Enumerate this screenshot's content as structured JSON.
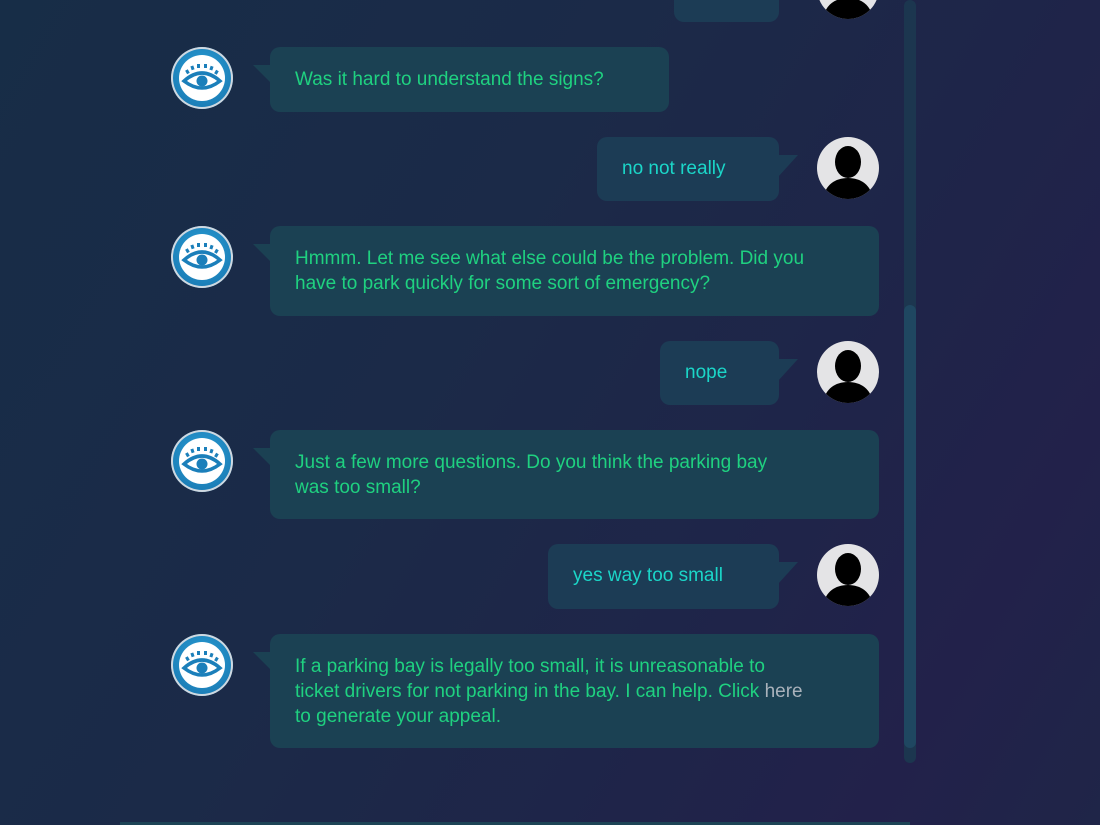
{
  "chat": {
    "messages": [
      {
        "sender": "user",
        "text": "",
        "partial": true
      },
      {
        "sender": "bot",
        "text": "Was it hard to understand the signs?"
      },
      {
        "sender": "user",
        "text": "no not really"
      },
      {
        "sender": "bot",
        "lines": [
          "Hmmm. Let me see what else could be the problem. Did you",
          "have to park quickly for some sort of emergency?"
        ]
      },
      {
        "sender": "user",
        "text": "nope"
      },
      {
        "sender": "bot",
        "lines": [
          "Just a few more questions. Do you think the parking bay",
          "was too small?"
        ]
      },
      {
        "sender": "user",
        "text": "yes way too small"
      },
      {
        "sender": "bot",
        "lines": [
          "If a parking bay is legally too small, it is unreasonable to",
          "ticket drivers for not parking in the bay. I can help. Click ",
          "to generate your appeal."
        ],
        "link_text": "here"
      }
    ],
    "bot_avatar_icon": "eye-icon",
    "user_avatar_icon": "user-silhouette-icon"
  },
  "colors": {
    "bot_text": "#1fd180",
    "user_text": "#1bd6c8",
    "bot_bubble": "#1b4153",
    "user_bubble": "#1c3c55",
    "link": "#a9b2bb"
  },
  "scrollbar": {
    "position_fraction": 0.4
  }
}
